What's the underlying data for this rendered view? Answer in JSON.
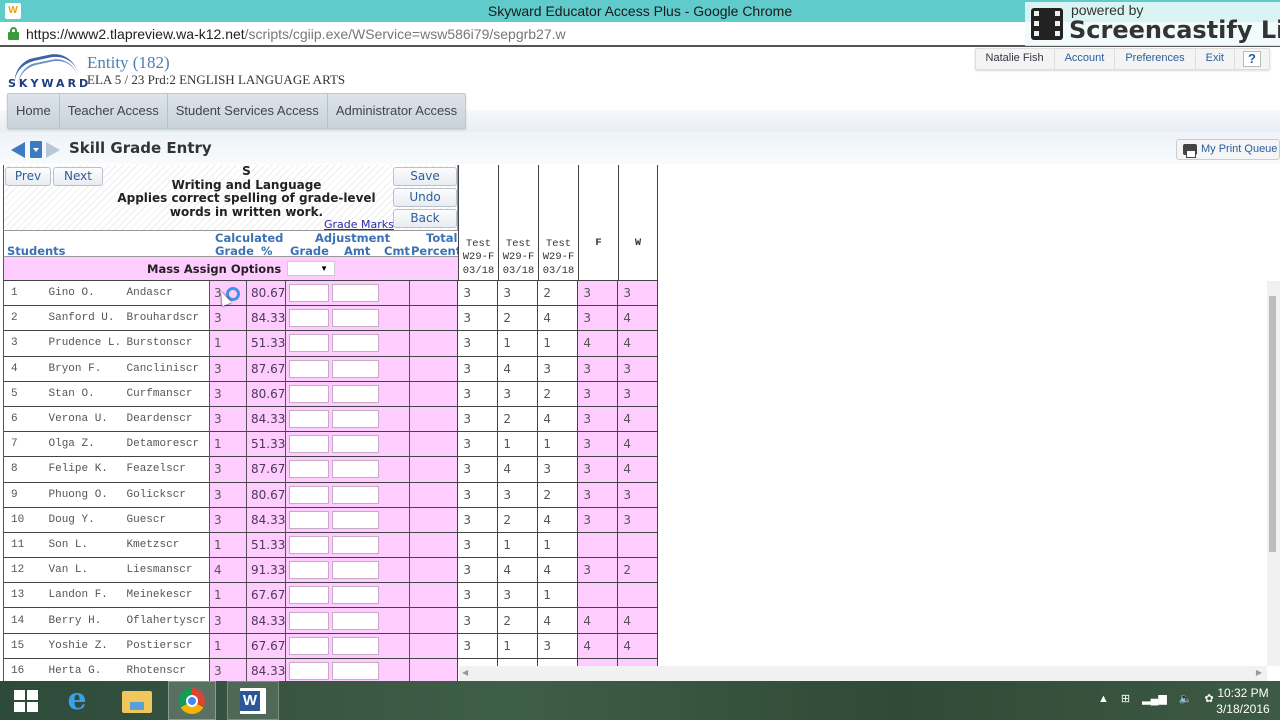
{
  "browser": {
    "window_title": "Skyward Educator Access Plus - Google Chrome",
    "url_host": "https://www2.tlapreview.wa-k12.net",
    "url_path": "/scripts/cgiip.exe/WService=wsw586i79/sepgrb27.w"
  },
  "overlay": {
    "powered_by": "powered by",
    "brand": "Screencastify Lite"
  },
  "header": {
    "logo_text": "SKYWARD",
    "entity": "Entity (182)",
    "course": "ELA 5 / 23 Prd:2 ENGLISH LANGUAGE ARTS",
    "top_nav": {
      "user": "Natalie Fish",
      "account": "Account",
      "preferences": "Preferences",
      "exit": "Exit",
      "help": "?"
    }
  },
  "main_nav": {
    "tabs": [
      "Home",
      "Teacher Access",
      "Student Services Access",
      "Administrator Access"
    ]
  },
  "page": {
    "title": "Skill Grade Entry",
    "print_queue": "My Print Queue"
  },
  "skill": {
    "prev": "Prev",
    "next": "Next",
    "code": "S",
    "category": "Writing and Language",
    "description_line1": "Applies correct spelling of grade-level",
    "description_line2": "words in written work.",
    "grade_marks_link": "Grade Marks",
    "save": "Save",
    "undo": "Undo",
    "back": "Back"
  },
  "columns": {
    "students": "Students",
    "calculated": "Calculated",
    "calc_grade": "Grade",
    "calc_pct": "%",
    "adjustment": "Adjustment",
    "adj_grade": "Grade",
    "adj_amt": "Amt",
    "adj_cmt": "Cmt",
    "total": "Total",
    "percent": "Percent",
    "tests": [
      {
        "line1": "Test",
        "line2": "W29-F",
        "line3": "03/18"
      },
      {
        "line1": "Test",
        "line2": "W29-F",
        "line3": "03/18"
      },
      {
        "line1": "Test",
        "line2": "W29-F",
        "line3": "03/18"
      }
    ],
    "f": "F",
    "w": "W"
  },
  "mass_assign": {
    "label": "Mass Assign Options",
    "selected": ""
  },
  "students": [
    {
      "num": "1",
      "first": "Gino O.",
      "last": "Andascr",
      "grade": "3",
      "pct": "80.67",
      "t1": "3",
      "t2": "3",
      "t3": "2",
      "f": "3",
      "w": "3"
    },
    {
      "num": "2",
      "first": "Sanford U.",
      "last": "Brouhardscr",
      "grade": "3",
      "pct": "84.33",
      "t1": "3",
      "t2": "2",
      "t3": "4",
      "f": "3",
      "w": "4"
    },
    {
      "num": "3",
      "first": "Prudence L.",
      "last": "Burstonscr",
      "grade": "1",
      "pct": "51.33",
      "t1": "3",
      "t2": "1",
      "t3": "1",
      "f": "4",
      "w": "4"
    },
    {
      "num": "4",
      "first": "Bryon F.",
      "last": "Cancliniscr",
      "grade": "3",
      "pct": "87.67",
      "t1": "3",
      "t2": "4",
      "t3": "3",
      "f": "3",
      "w": "3"
    },
    {
      "num": "5",
      "first": "Stan O.",
      "last": "Curfmanscr",
      "grade": "3",
      "pct": "80.67",
      "t1": "3",
      "t2": "3",
      "t3": "2",
      "f": "3",
      "w": "3"
    },
    {
      "num": "6",
      "first": "Verona U.",
      "last": "Deardenscr",
      "grade": "3",
      "pct": "84.33",
      "t1": "3",
      "t2": "2",
      "t3": "4",
      "f": "3",
      "w": "4"
    },
    {
      "num": "7",
      "first": "Olga Z.",
      "last": "Detamorescr",
      "grade": "1",
      "pct": "51.33",
      "t1": "3",
      "t2": "1",
      "t3": "1",
      "f": "3",
      "w": "4"
    },
    {
      "num": "8",
      "first": "Felipe K.",
      "last": "Feazelscr",
      "grade": "3",
      "pct": "87.67",
      "t1": "3",
      "t2": "4",
      "t3": "3",
      "f": "3",
      "w": "4"
    },
    {
      "num": "9",
      "first": "Phuong O.",
      "last": "Golickscr",
      "grade": "3",
      "pct": "80.67",
      "t1": "3",
      "t2": "3",
      "t3": "2",
      "f": "3",
      "w": "3"
    },
    {
      "num": "10",
      "first": "Doug Y.",
      "last": "Guescr",
      "grade": "3",
      "pct": "84.33",
      "t1": "3",
      "t2": "2",
      "t3": "4",
      "f": "3",
      "w": "3"
    },
    {
      "num": "11",
      "first": "Son L.",
      "last": "Kmetzscr",
      "grade": "1",
      "pct": "51.33",
      "t1": "3",
      "t2": "1",
      "t3": "1",
      "f": "",
      "w": ""
    },
    {
      "num": "12",
      "first": "Van L.",
      "last": "Liesmanscr",
      "grade": "4",
      "pct": "91.33",
      "t1": "3",
      "t2": "4",
      "t3": "4",
      "f": "3",
      "w": "2"
    },
    {
      "num": "13",
      "first": "Landon F.",
      "last": "Meinekescr",
      "grade": "1",
      "pct": "67.67",
      "t1": "3",
      "t2": "3",
      "t3": "1",
      "f": "",
      "w": ""
    },
    {
      "num": "14",
      "first": "Berry H.",
      "last": "Oflahertyscr",
      "grade": "3",
      "pct": "84.33",
      "t1": "3",
      "t2": "2",
      "t3": "4",
      "f": "4",
      "w": "4"
    },
    {
      "num": "15",
      "first": "Yoshie Z.",
      "last": "Postierscr",
      "grade": "1",
      "pct": "67.67",
      "t1": "3",
      "t2": "1",
      "t3": "3",
      "f": "4",
      "w": "4"
    },
    {
      "num": "16",
      "first": "Herta G.",
      "last": "Rhotenscr",
      "grade": "3",
      "pct": "84.33",
      "t1": "",
      "t2": "",
      "t3": "",
      "f": "",
      "w": ""
    }
  ],
  "taskbar": {
    "time": "10:32 PM",
    "date": "3/18/2016"
  }
}
